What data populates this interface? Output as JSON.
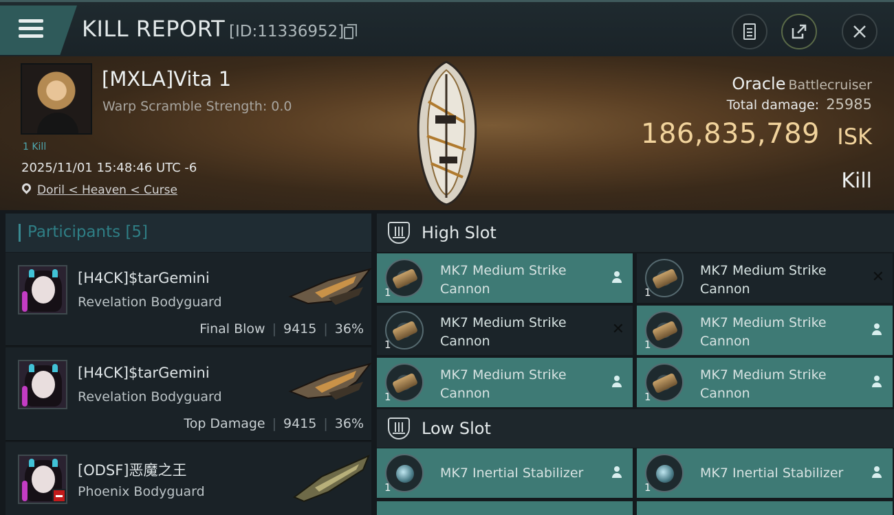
{
  "header": {
    "title": "KILL REPORT",
    "report_id": "[ID:11336952]"
  },
  "victim": {
    "name": "[MXLA]Vita 1",
    "warp_scramble": "Warp Scramble Strength: 0.0",
    "kill_count": "1 Kill",
    "timestamp": "2025/11/01 15:48:46 UTC -6",
    "location": "Doril < Heaven < Curse",
    "ship_name": "Oracle",
    "ship_class": "Battlecruiser",
    "total_damage_label": "Total damage:",
    "total_damage": "25985",
    "isk_value": "186,835,789",
    "isk_unit": "ISK",
    "result": "Kill"
  },
  "participants": {
    "title": "Participants [5]",
    "rows": [
      {
        "name": "[H4CK]$tarGemini",
        "ship": "Revelation Bodyguard",
        "role": "Final Blow",
        "damage": "9415",
        "percent": "36%"
      },
      {
        "name": "[H4CK]$tarGemini",
        "ship": "Revelation Bodyguard",
        "role": "Top Damage",
        "damage": "9415",
        "percent": "36%"
      },
      {
        "name": "[ODSF]恶魔之王",
        "ship": "Phoenix Bodyguard"
      }
    ]
  },
  "slots": {
    "high": {
      "title": "High Slot",
      "modules": [
        {
          "name": "MK7 Medium Strike Cannon",
          "qty": "1",
          "state": "dropped"
        },
        {
          "name": "MK7 Medium Strike Cannon",
          "qty": "1",
          "state": "destroyed"
        },
        {
          "name": "MK7 Medium Strike Cannon",
          "qty": "1",
          "state": "destroyed"
        },
        {
          "name": "MK7 Medium Strike Cannon",
          "qty": "1",
          "state": "dropped"
        },
        {
          "name": "MK7 Medium Strike Cannon",
          "qty": "1",
          "state": "dropped"
        },
        {
          "name": "MK7 Medium Strike Cannon",
          "qty": "1",
          "state": "dropped"
        }
      ]
    },
    "low": {
      "title": "Low Slot",
      "modules": [
        {
          "name": "MK7 Inertial Stabilizer",
          "qty": "1",
          "state": "dropped"
        },
        {
          "name": "MK7 Inertial Stabilizer",
          "qty": "1",
          "state": "dropped"
        }
      ]
    }
  },
  "icons": {
    "menu": "hamburger-menu-icon",
    "copy": "copy-icon",
    "clipboard": "clipboard-icon",
    "share": "share-icon",
    "close": "close-icon",
    "location": "location-pin-icon",
    "slot": "module-slot-icon",
    "pilot": "user-icon",
    "destroyed": "x-icon"
  },
  "colors": {
    "accent_teal": "#3e7a75",
    "isk_gold": "#f1d39c",
    "header_bg": "#1f2a2f"
  }
}
